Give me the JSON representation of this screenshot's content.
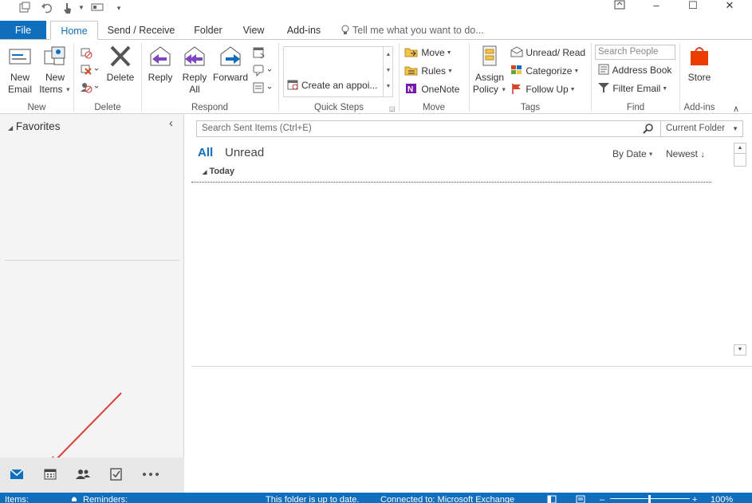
{
  "quick_access": {
    "items": [
      "send-receive-icon",
      "undo-icon",
      "touch-mode-icon",
      "customize-icon"
    ]
  },
  "window_controls": {
    "restore": "restore-ribbon-icon",
    "minimize": "–",
    "maximize": "☐",
    "close": "✕"
  },
  "tabs": [
    {
      "label": "File"
    },
    {
      "label": "Home"
    },
    {
      "label": "Send / Receive"
    },
    {
      "label": "Folder"
    },
    {
      "label": "View"
    },
    {
      "label": "Add-ins"
    }
  ],
  "tell_me": {
    "placeholder": "Tell me what you want to do..."
  },
  "ribbon": {
    "new": {
      "new_email": "New Email",
      "new_email_l1": "New",
      "new_email_l2": "Email",
      "new_items_l1": "New",
      "new_items_l2": "Items",
      "label": "New"
    },
    "delete": {
      "delete": "Delete",
      "label": "Delete"
    },
    "respond": {
      "reply": "Reply",
      "reply_all_l1": "Reply",
      "reply_all_l2": "All",
      "forward": "Forward",
      "label": "Respond"
    },
    "quick_steps": {
      "create_appointment": "Create an appoi...",
      "label": "Quick Steps"
    },
    "move": {
      "move": "Move",
      "rules": "Rules",
      "onenote": "OneNote",
      "label": "Move"
    },
    "tags": {
      "assign_l1": "Assign",
      "assign_l2": "Policy",
      "unread_read": "Unread/ Read",
      "categorize": "Categorize",
      "follow_up": "Follow Up",
      "label": "Tags"
    },
    "find": {
      "search_people_placeholder": "Search People",
      "address_book": "Address Book",
      "filter_email": "Filter Email",
      "label": "Find"
    },
    "addins": {
      "store": "Store",
      "label": "Add-ins"
    }
  },
  "left_nav": {
    "favorites": "Favorites",
    "collapse": "‹"
  },
  "bottom_nav": [
    "mail-icon",
    "calendar-icon",
    "people-icon",
    "tasks-icon",
    "more-icon"
  ],
  "mail_list": {
    "search_placeholder": "Search Sent Items (Ctrl+E)",
    "scope": "Current Folder",
    "filter_all": "All",
    "filter_unread": "Unread",
    "sort_by": "By Date",
    "sort_order": "Newest",
    "group_today": "Today"
  },
  "status_bar": {
    "items": "Items:",
    "reminders": "Reminders:",
    "folder_status": "This folder is up to date.",
    "connection": "Connected to: Microsoft Exchange",
    "zoom": "100%"
  },
  "colors": {
    "accent": "#106ebe",
    "annotation_arrow": "#d9413a"
  }
}
